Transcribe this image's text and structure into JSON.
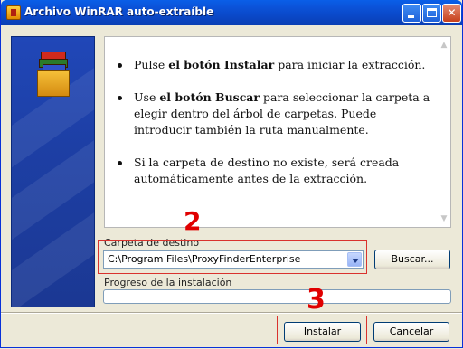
{
  "window": {
    "title": "Archivo WinRAR auto-extraíble"
  },
  "info": {
    "items": [
      {
        "pre": "Pulse ",
        "bold": "el botón Instalar",
        "post": " para iniciar la extracción."
      },
      {
        "pre": "Use ",
        "bold": "el botón Buscar",
        "post": " para seleccionar la carpeta a elegir dentro del árbol de carpetas. Puede introducir también la ruta manualmente."
      },
      {
        "pre": "Si la carpeta de destino no existe, será creada automáticamente antes de la extracción.",
        "bold": "",
        "post": ""
      }
    ]
  },
  "destination": {
    "label": "Carpeta de destino",
    "value": "C:\\Program Files\\ProxyFinderEnterprise",
    "browse_label": "Buscar..."
  },
  "progress": {
    "label": "Progreso de la instalación",
    "value": 0
  },
  "buttons": {
    "install_label": "Instalar",
    "cancel_label": "Cancelar"
  },
  "annotations": {
    "step2": "2",
    "step3": "3",
    "color": "#e00000"
  },
  "colors": {
    "titlebar": "#0a4fd0",
    "side_panel": "#1d3fa5",
    "dialog_bg": "#ece9d8"
  }
}
